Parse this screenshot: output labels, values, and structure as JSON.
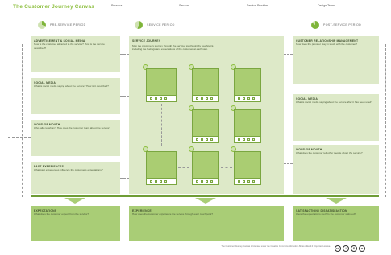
{
  "title": "The Customer Journey Canvas",
  "header_fields": [
    "Persona",
    "Service",
    "Service Provider",
    "Design Team"
  ],
  "columns": {
    "before": "PRE-SERVICE PERIOD",
    "service": "SERVICE PERIOD",
    "after": "POST-SERVICE PERIOD"
  },
  "left_boxes": [
    {
      "title": "ADVERTISEMENT & SOCIAL MEDIA",
      "text": "How is the customer attracted to the service? How is the service described?"
    },
    {
      "title": "SOCIAL MEDIA",
      "text": "What is social media saying about the service? How is it described?"
    },
    {
      "title": "WORD OF MOUTH",
      "text": "Who talks to whom? How does the customer learn about the service?"
    },
    {
      "title": "PAST EXPERIENCES",
      "text": "What past experiences influence the customer's expectations?"
    }
  ],
  "center": {
    "title": "SERVICE JOURNEY",
    "text_1": "Map the customer's journey through the service, touchpoint by touchpoint,",
    "text_2": "including the feelings and expectations of the customer at each step.",
    "touchpoint_count": 6
  },
  "right_boxes": [
    {
      "title": "CUSTOMER RELATIONSHIP MANAGEMENT",
      "text": "How does the provider stay in touch with the customer?"
    },
    {
      "title": "SOCIAL MEDIA",
      "text": "What is social media saying about the service after it has been used?"
    },
    {
      "title": "WORD OF MOUTH",
      "text": "What does the customer tell other people about the service?"
    }
  ],
  "bottom_boxes": [
    {
      "title": "EXPECTATIONS",
      "text": "What does the customer expect from the service?"
    },
    {
      "title": "EXPERIENCE",
      "text": "How does the customer experience the service through each touchpoint?"
    },
    {
      "title": "SATISFACTION / DISSATISFACTION",
      "text": "Were the expectations met? Is the customer satisfied?"
    }
  ],
  "footer": {
    "text": "The Customer Journey Canvas is licensed under the Creative Commons Attribution-Share Alike 3.0 Unported License.",
    "license_icons": [
      "cc-icon",
      "by-icon",
      "nc-icon",
      "sa-icon"
    ]
  },
  "colors": {
    "accent": "#8dbf3f",
    "box": "#dde9c8",
    "box_dark": "#a9cd76",
    "card": "#aacd72"
  }
}
